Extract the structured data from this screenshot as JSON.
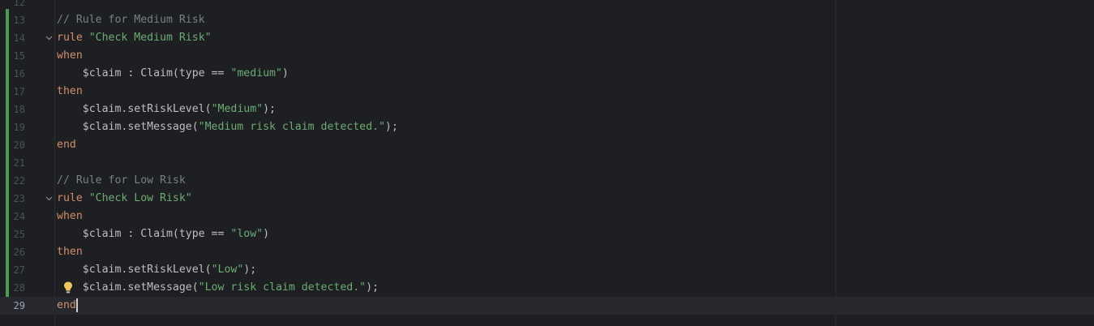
{
  "editor": {
    "language": "drools",
    "lines": [
      {
        "n": "12",
        "parts": []
      },
      {
        "n": "13",
        "parts": [
          {
            "cls": "cmt",
            "t": "// Rule for Medium Risk"
          }
        ]
      },
      {
        "n": "14",
        "fold": true,
        "parts": [
          {
            "cls": "kw",
            "t": "rule"
          },
          {
            "cls": "plain",
            "t": " "
          },
          {
            "cls": "str",
            "t": "\"Check Medium Risk\""
          }
        ]
      },
      {
        "n": "15",
        "parts": [
          {
            "cls": "kw",
            "t": "when"
          }
        ]
      },
      {
        "n": "16",
        "parts": [
          {
            "cls": "plain",
            "t": "    $claim : Claim(type == "
          },
          {
            "cls": "str",
            "t": "\"medium\""
          },
          {
            "cls": "plain",
            "t": ")"
          }
        ]
      },
      {
        "n": "17",
        "parts": [
          {
            "cls": "kw",
            "t": "then"
          }
        ]
      },
      {
        "n": "18",
        "parts": [
          {
            "cls": "plain",
            "t": "    $claim.setRiskLevel("
          },
          {
            "cls": "str",
            "t": "\"Medium\""
          },
          {
            "cls": "plain",
            "t": ");"
          }
        ]
      },
      {
        "n": "19",
        "parts": [
          {
            "cls": "plain",
            "t": "    $claim.setMessage("
          },
          {
            "cls": "str",
            "t": "\"Medium risk claim detected.\""
          },
          {
            "cls": "plain",
            "t": ");"
          }
        ]
      },
      {
        "n": "20",
        "parts": [
          {
            "cls": "kw",
            "t": "end"
          }
        ]
      },
      {
        "n": "21",
        "parts": []
      },
      {
        "n": "22",
        "parts": [
          {
            "cls": "cmt",
            "t": "// Rule for Low Risk"
          }
        ]
      },
      {
        "n": "23",
        "fold": true,
        "parts": [
          {
            "cls": "kw",
            "t": "rule"
          },
          {
            "cls": "plain",
            "t": " "
          },
          {
            "cls": "str",
            "t": "\"Check Low Risk\""
          }
        ]
      },
      {
        "n": "24",
        "parts": [
          {
            "cls": "kw",
            "t": "when"
          }
        ]
      },
      {
        "n": "25",
        "parts": [
          {
            "cls": "plain",
            "t": "    $claim : Claim(type == "
          },
          {
            "cls": "str",
            "t": "\"low\""
          },
          {
            "cls": "plain",
            "t": ")"
          }
        ]
      },
      {
        "n": "26",
        "parts": [
          {
            "cls": "kw",
            "t": "then"
          }
        ]
      },
      {
        "n": "27",
        "parts": [
          {
            "cls": "plain",
            "t": "    $claim.setRiskLevel("
          },
          {
            "cls": "str",
            "t": "\"Low\""
          },
          {
            "cls": "plain",
            "t": ");"
          }
        ]
      },
      {
        "n": "28",
        "bulb": true,
        "parts": [
          {
            "cls": "plain",
            "t": "    $claim.setMessage("
          },
          {
            "cls": "str",
            "t": "\"Low risk claim detected.\""
          },
          {
            "cls": "plain",
            "t": ");"
          }
        ]
      },
      {
        "n": "29",
        "current": true,
        "caret": true,
        "parts": [
          {
            "cls": "kw",
            "t": "end"
          }
        ]
      }
    ]
  },
  "icons": {
    "fold": "chevron-down-icon",
    "bulb": "lightbulb-icon"
  },
  "colors": {
    "background": "#1e1f22",
    "keyword": "#cf8e6d",
    "string": "#6aab73",
    "comment": "#7a7e85",
    "text": "#bcbec4",
    "vcs_changed": "#499c54",
    "bulb": "#f2c55c"
  }
}
